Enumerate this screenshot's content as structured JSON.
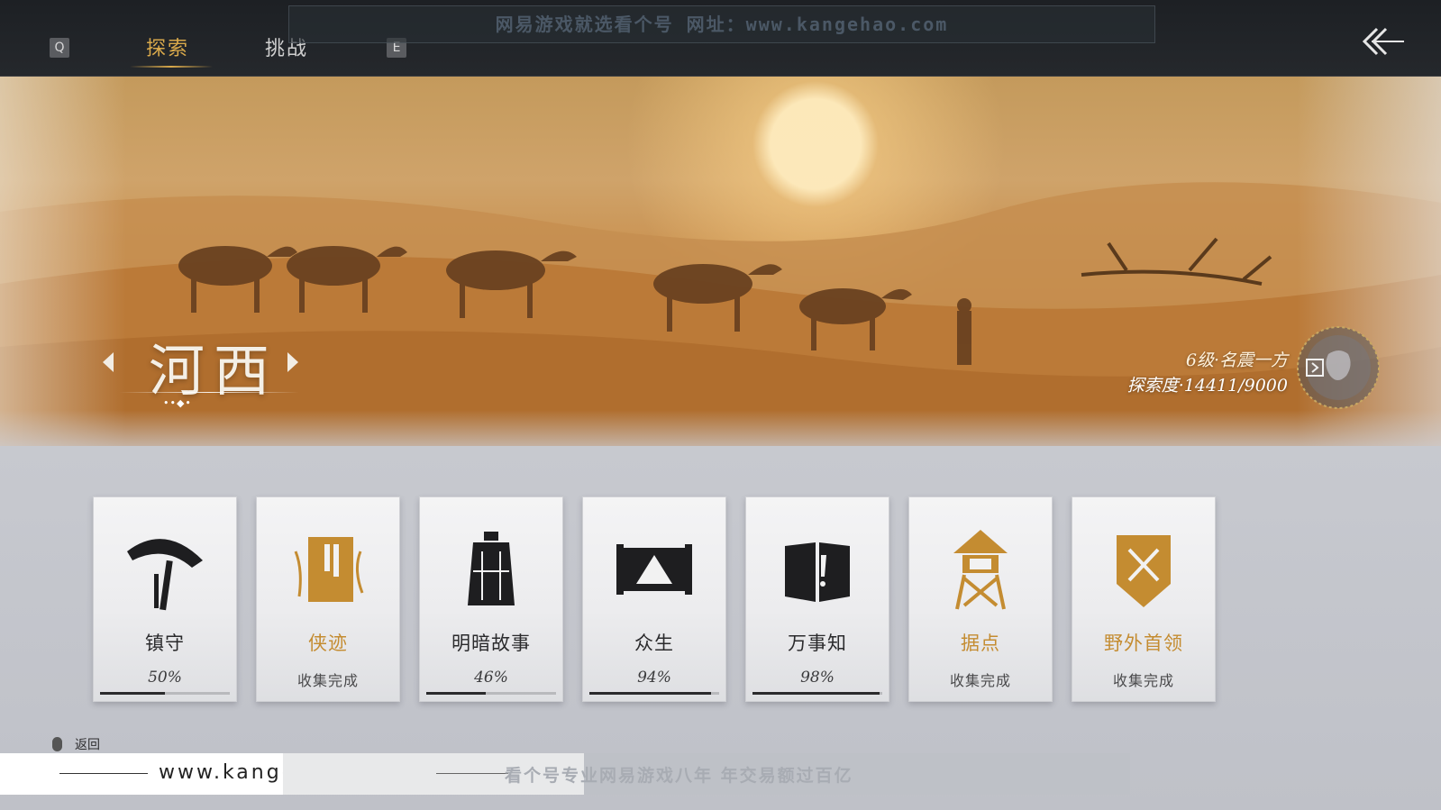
{
  "top_bar": {
    "key_left": "Q",
    "key_right": "E",
    "tabs": [
      {
        "label": "探索",
        "active": true
      },
      {
        "label": "挑战",
        "active": false
      }
    ],
    "watermark": "网易游戏就选看个号   网址：www.kangehao.com"
  },
  "region": {
    "name": "河西",
    "dots": "••◆•",
    "level": "6级·名震一方",
    "exploration": "探索度·14411/9000"
  },
  "cards": [
    {
      "title": "镇守",
      "status": "50%",
      "progress": 0.5,
      "accent": "#2a2a2c",
      "icon": "hat-sword-icon"
    },
    {
      "title": "侠迹",
      "status": "收集完成",
      "progress": null,
      "accent": "#c48c31",
      "icon": "book-icon"
    },
    {
      "title": "明暗故事",
      "status": "46%",
      "progress": 0.46,
      "accent": "#2a2a2c",
      "icon": "bell-icon"
    },
    {
      "title": "众生",
      "status": "94%",
      "progress": 0.94,
      "accent": "#2a2a2c",
      "icon": "scroll-painting-icon"
    },
    {
      "title": "万事知",
      "status": "98%",
      "progress": 0.98,
      "accent": "#2a2a2c",
      "icon": "open-book-icon"
    },
    {
      "title": "据点",
      "status": "收集完成",
      "progress": null,
      "accent": "#c48c31",
      "icon": "watchtower-icon"
    },
    {
      "title": "野外首领",
      "status": "收集完成",
      "progress": null,
      "accent": "#c48c31",
      "icon": "crossed-swords-banner-icon"
    }
  ],
  "bottom": {
    "back_label": "返回",
    "site": "www.kangehao.com",
    "tagline": "看个号专业网易游戏八年   年交易额过百亿"
  },
  "colors": {
    "gold": "#c48c31",
    "tab_active": "#d9a94b",
    "topbar": "#1d2024"
  }
}
